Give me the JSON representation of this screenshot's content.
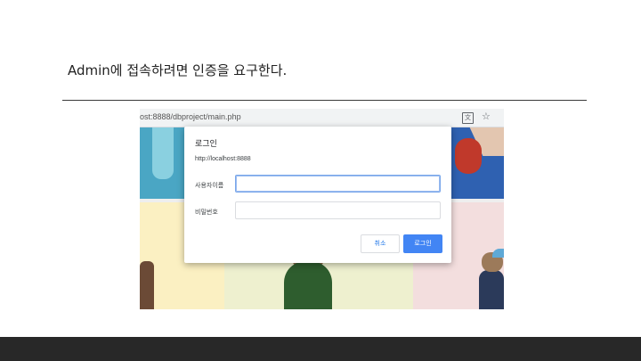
{
  "slide": {
    "title": "Admin에 접속하려면 인증을 요구한다."
  },
  "browser": {
    "url": "ost:8888/dbproject/main.php",
    "icons": [
      "translate-icon",
      "star-icon"
    ]
  },
  "dialog": {
    "title": "로그인",
    "site": "http://localhost:8888",
    "username_label": "사용자이름",
    "username_value": "",
    "password_label": "비밀번호",
    "password_value": "",
    "cancel_label": "취소",
    "login_label": "로그인"
  },
  "colors": {
    "primary_button": "#4285f4",
    "footer": "#282828"
  }
}
